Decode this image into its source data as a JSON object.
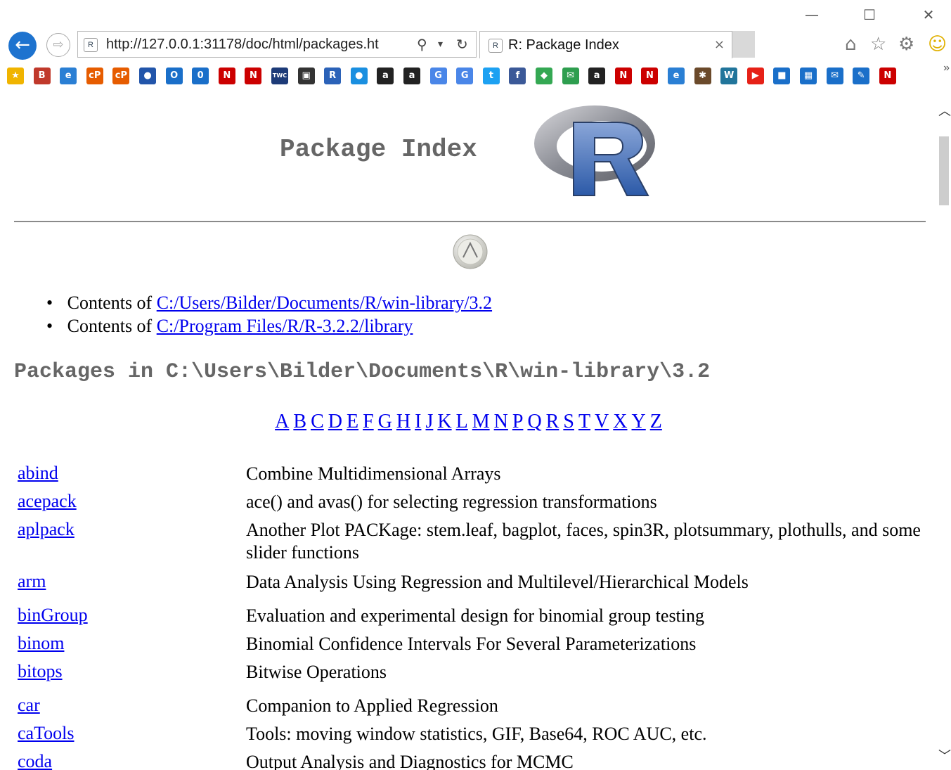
{
  "window": {
    "controls": {
      "minimize": "—",
      "maximize": "☐",
      "close": "✕"
    }
  },
  "browser": {
    "url": "http://127.0.0.1:31178/doc/html/packages.ht",
    "tab_title": "R: Package Index",
    "tab_close": "×",
    "favicon_text": "R",
    "icons": [
      "back-icon",
      "forward-icon",
      "search-icon",
      "dropdown-icon",
      "refresh-icon",
      "home-icon",
      "favorites-star-icon",
      "settings-gear-icon",
      "smiley-feedback-icon"
    ]
  },
  "favorites_bar": {
    "more": "»",
    "items": [
      {
        "icon": "add-favorite-star",
        "glyph": "★",
        "color": "#f0b400"
      },
      {
        "icon": "b-icon",
        "glyph": "B",
        "color": "#c0392b"
      },
      {
        "icon": "ie-icon",
        "glyph": "e",
        "color": "#2a7fd4"
      },
      {
        "icon": "cp-icon",
        "glyph": "cP",
        "color": "#e65c00"
      },
      {
        "icon": "cp-icon-2",
        "glyph": "cP",
        "color": "#e65c00"
      },
      {
        "icon": "circle-icon",
        "glyph": "●",
        "color": "#2255aa"
      },
      {
        "icon": "outlook-icon",
        "glyph": "O",
        "color": "#1a6fc9"
      },
      {
        "icon": "zero-icon",
        "glyph": "0",
        "color": "#1a6fc9"
      },
      {
        "icon": "n-icon",
        "glyph": "N",
        "color": "#cc0000"
      },
      {
        "icon": "n-icon-2",
        "glyph": "N",
        "color": "#cc0000"
      },
      {
        "icon": "twc-icon",
        "glyph": "TWC",
        "color": "#1d3b78"
      },
      {
        "icon": "box-icon",
        "glyph": "▣",
        "color": "#333333"
      },
      {
        "icon": "r-icon",
        "glyph": "R",
        "color": "#2b62b8"
      },
      {
        "icon": "dot-icon",
        "glyph": "●",
        "color": "#1a8fe0"
      },
      {
        "icon": "amazon-icon",
        "glyph": "a",
        "color": "#222222"
      },
      {
        "icon": "amazon-icon-2",
        "glyph": "a",
        "color": "#222222"
      },
      {
        "icon": "google-scholar-icon",
        "glyph": "G",
        "color": "#4a86e8"
      },
      {
        "icon": "google-icon",
        "glyph": "G",
        "color": "#4a86e8"
      },
      {
        "icon": "twitter-icon",
        "glyph": "t",
        "color": "#1da1f2"
      },
      {
        "icon": "facebook-icon",
        "glyph": "f",
        "color": "#3b5998"
      },
      {
        "icon": "maps-icon",
        "glyph": "◆",
        "color": "#34a853"
      },
      {
        "icon": "mail-icon",
        "glyph": "✉",
        "color": "#2e9e4f"
      },
      {
        "icon": "amazon-icon-3",
        "glyph": "a",
        "color": "#222222"
      },
      {
        "icon": "n-icon-3",
        "glyph": "N",
        "color": "#cc0000"
      },
      {
        "icon": "n-icon-4",
        "glyph": "N",
        "color": "#cc0000"
      },
      {
        "icon": "ie-icon-2",
        "glyph": "e",
        "color": "#2a7fd4"
      },
      {
        "icon": "deer-icon",
        "glyph": "✱",
        "color": "#6b4a2b"
      },
      {
        "icon": "wordpress-icon",
        "glyph": "W",
        "color": "#21759b"
      },
      {
        "icon": "youtube-icon",
        "glyph": "▶",
        "color": "#e62117"
      },
      {
        "icon": "square-icon",
        "glyph": "■",
        "color": "#1a6fc9"
      },
      {
        "icon": "calendar-icon",
        "glyph": "▦",
        "color": "#1a6fc9"
      },
      {
        "icon": "envelope-icon",
        "glyph": "✉",
        "color": "#1a6fc9"
      },
      {
        "icon": "pen-icon",
        "glyph": "✎",
        "color": "#1a6fc9"
      },
      {
        "icon": "n-icon-5",
        "glyph": "N",
        "color": "#cc0000"
      }
    ]
  },
  "page": {
    "title": "Package Index",
    "contents": [
      {
        "prefix": "Contents of ",
        "link": "C:/Users/Bilder/Documents/R/win-library/3.2"
      },
      {
        "prefix": "Contents of ",
        "link": "C:/Program Files/R/R-3.2.2/library"
      }
    ],
    "section_heading": "Packages in C:\\Users\\Bilder\\Documents\\R\\win-library\\3.2",
    "letters": [
      "A",
      "B",
      "C",
      "D",
      "E",
      "F",
      "G",
      "H",
      "I",
      "J",
      "K",
      "L",
      "M",
      "N",
      "P",
      "Q",
      "R",
      "S",
      "T",
      "V",
      "X",
      "Y",
      "Z"
    ],
    "packages": [
      {
        "name": "abind",
        "desc": "Combine Multidimensional Arrays"
      },
      {
        "name": "acepack",
        "desc": "ace() and avas() for selecting regression transformations"
      },
      {
        "name": "aplpack",
        "desc": "Another Plot PACKage: stem.leaf, bagplot, faces, spin3R, plotsummary, plothulls, and some slider functions"
      },
      {
        "name": "arm",
        "desc": "Data Analysis Using Regression and Multilevel/Hierarchical Models"
      },
      {
        "name": "binGroup",
        "desc": "Evaluation and experimental design for binomial group testing"
      },
      {
        "name": "binom",
        "desc": "Binomial Confidence Intervals For Several Parameterizations"
      },
      {
        "name": "bitops",
        "desc": "Bitwise Operations"
      },
      {
        "name": "car",
        "desc": "Companion to Applied Regression"
      },
      {
        "name": "caTools",
        "desc": "Tools: moving window statistics, GIF, Base64, ROC AUC, etc."
      },
      {
        "name": "coda",
        "desc": "Output Analysis and Diagnostics for MCMC"
      }
    ]
  }
}
